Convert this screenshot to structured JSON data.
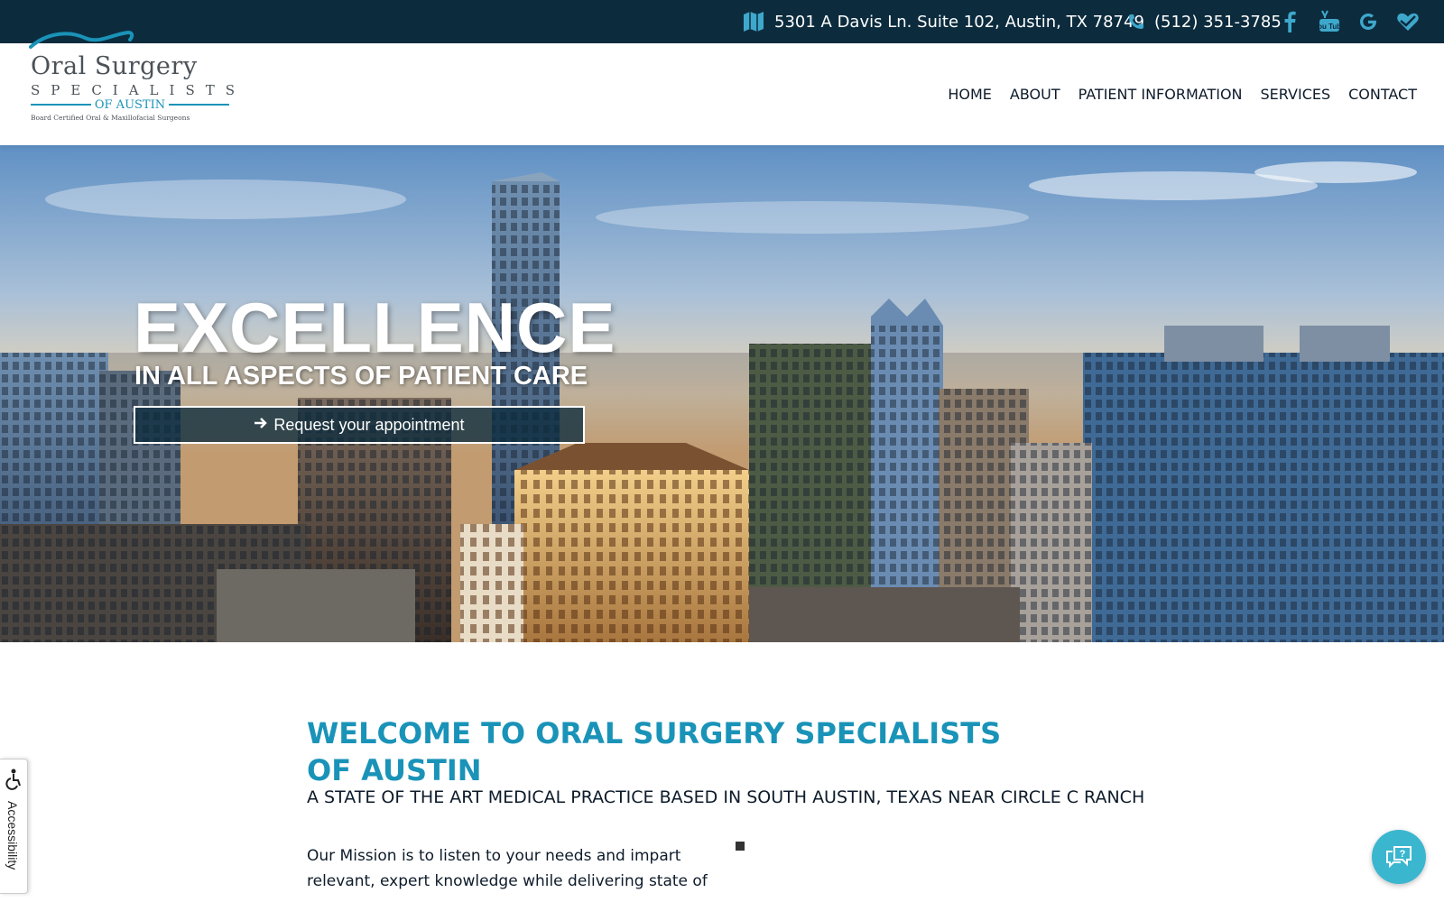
{
  "topbar": {
    "address": "5301 A Davis Ln. Suite 102, Austin, TX 78749",
    "phone": "(512) 351-3785",
    "icons": [
      "map-icon",
      "phone-icon",
      "facebook-icon",
      "youtube-icon",
      "google-icon",
      "healthgrades-icon"
    ],
    "youtube_text": "You Tube"
  },
  "logo": {
    "line1": "Oral Surgery",
    "line2": "SPECIALISTS",
    "line3": "OF AUSTIN",
    "line4": "Board Certified Oral & Maxillofacial Surgeons"
  },
  "nav": {
    "items": [
      "HOME",
      "ABOUT",
      "PATIENT INFORMATION",
      "SERVICES",
      "CONTACT"
    ]
  },
  "hero": {
    "title": "EXCELLENCE",
    "subtitle": "IN ALL ASPECTS OF PATIENT CARE",
    "cta_label": "Request your appointment"
  },
  "welcome": {
    "title": "WELCOME TO ORAL SURGERY SPECIALISTS OF AUSTIN",
    "subtitle": "A STATE OF THE ART MEDICAL PRACTICE BASED IN SOUTH AUSTIN, TEXAS NEAR CIRCLE C RANCH",
    "mission": "Our Mission is to listen to your needs and impart relevant, expert knowledge while delivering state of"
  },
  "accessibility": {
    "label": "Accessibility"
  },
  "chat": {
    "icon": "chat-icon"
  },
  "colors": {
    "topbar": "#0c2c3e",
    "accent": "#1a93b8",
    "chat": "#3bb6cf"
  }
}
